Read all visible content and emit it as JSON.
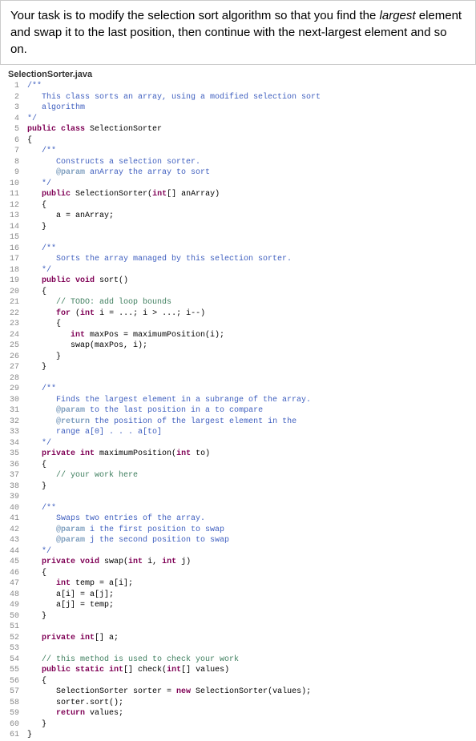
{
  "task": {
    "prefix": "Your task is to modify the selection sort algorithm so that you find the ",
    "italic1": "largest",
    "mid": " element and swap it to the last position, then continue with the next-largest element and so on."
  },
  "filename": "SelectionSorter.java",
  "lines": [
    {
      "n": "1",
      "spans": [
        {
          "c": "javadoc",
          "t": "/**"
        }
      ]
    },
    {
      "n": "2",
      "spans": [
        {
          "c": "javadoc",
          "t": "   This class sorts an array, using a modified selection sort"
        }
      ]
    },
    {
      "n": "3",
      "spans": [
        {
          "c": "javadoc",
          "t": "   algorithm"
        }
      ]
    },
    {
      "n": "4",
      "spans": [
        {
          "c": "javadoc",
          "t": "*/"
        }
      ]
    },
    {
      "n": "5",
      "spans": [
        {
          "c": "kw",
          "t": "public class"
        },
        {
          "c": "normal",
          "t": " SelectionSorter"
        }
      ]
    },
    {
      "n": "6",
      "spans": [
        {
          "c": "normal",
          "t": "{"
        }
      ]
    },
    {
      "n": "7",
      "spans": [
        {
          "c": "javadoc",
          "t": "   /**"
        }
      ]
    },
    {
      "n": "8",
      "spans": [
        {
          "c": "javadoc",
          "t": "      Constructs a selection sorter."
        }
      ]
    },
    {
      "n": "9",
      "spans": [
        {
          "c": "javadoc",
          "t": "      "
        },
        {
          "c": "tag",
          "t": "@param"
        },
        {
          "c": "javadoc",
          "t": " anArray the array to sort"
        }
      ]
    },
    {
      "n": "10",
      "spans": [
        {
          "c": "javadoc",
          "t": "   */"
        }
      ]
    },
    {
      "n": "11",
      "spans": [
        {
          "c": "normal",
          "t": "   "
        },
        {
          "c": "kw",
          "t": "public"
        },
        {
          "c": "normal",
          "t": " SelectionSorter("
        },
        {
          "c": "kw",
          "t": "int"
        },
        {
          "c": "normal",
          "t": "[] anArray)"
        }
      ]
    },
    {
      "n": "12",
      "spans": [
        {
          "c": "normal",
          "t": "   {"
        }
      ]
    },
    {
      "n": "13",
      "spans": [
        {
          "c": "normal",
          "t": "      a = anArray;"
        }
      ]
    },
    {
      "n": "14",
      "spans": [
        {
          "c": "normal",
          "t": "   }"
        }
      ]
    },
    {
      "n": "15",
      "spans": [
        {
          "c": "normal",
          "t": ""
        }
      ]
    },
    {
      "n": "16",
      "spans": [
        {
          "c": "javadoc",
          "t": "   /**"
        }
      ]
    },
    {
      "n": "17",
      "spans": [
        {
          "c": "javadoc",
          "t": "      Sorts the array managed by this selection sorter."
        }
      ]
    },
    {
      "n": "18",
      "spans": [
        {
          "c": "javadoc",
          "t": "   */"
        }
      ]
    },
    {
      "n": "19",
      "spans": [
        {
          "c": "normal",
          "t": "   "
        },
        {
          "c": "kw",
          "t": "public void"
        },
        {
          "c": "normal",
          "t": " sort()"
        }
      ]
    },
    {
      "n": "20",
      "spans": [
        {
          "c": "normal",
          "t": "   {"
        }
      ]
    },
    {
      "n": "21",
      "spans": [
        {
          "c": "normal",
          "t": "      "
        },
        {
          "c": "comment",
          "t": "// TODO: add loop bounds"
        }
      ]
    },
    {
      "n": "22",
      "spans": [
        {
          "c": "normal",
          "t": "      "
        },
        {
          "c": "kw",
          "t": "for"
        },
        {
          "c": "normal",
          "t": " ("
        },
        {
          "c": "kw",
          "t": "int"
        },
        {
          "c": "normal",
          "t": " i = ...; i > ...; i--)"
        }
      ]
    },
    {
      "n": "23",
      "spans": [
        {
          "c": "normal",
          "t": "      {"
        }
      ]
    },
    {
      "n": "24",
      "spans": [
        {
          "c": "normal",
          "t": "         "
        },
        {
          "c": "kw",
          "t": "int"
        },
        {
          "c": "normal",
          "t": " maxPos = maximumPosition(i);"
        }
      ]
    },
    {
      "n": "25",
      "spans": [
        {
          "c": "normal",
          "t": "         swap(maxPos, i);"
        }
      ]
    },
    {
      "n": "26",
      "spans": [
        {
          "c": "normal",
          "t": "      }"
        }
      ]
    },
    {
      "n": "27",
      "spans": [
        {
          "c": "normal",
          "t": "   }"
        }
      ]
    },
    {
      "n": "28",
      "spans": [
        {
          "c": "normal",
          "t": ""
        }
      ]
    },
    {
      "n": "29",
      "spans": [
        {
          "c": "javadoc",
          "t": "   /**"
        }
      ]
    },
    {
      "n": "30",
      "spans": [
        {
          "c": "javadoc",
          "t": "      Finds the largest element in a subrange of the array."
        }
      ]
    },
    {
      "n": "31",
      "spans": [
        {
          "c": "javadoc",
          "t": "      "
        },
        {
          "c": "tag",
          "t": "@param"
        },
        {
          "c": "javadoc",
          "t": " to the last position in a to compare"
        }
      ]
    },
    {
      "n": "32",
      "spans": [
        {
          "c": "javadoc",
          "t": "      "
        },
        {
          "c": "tag",
          "t": "@return"
        },
        {
          "c": "javadoc",
          "t": " the position of the largest element in the"
        }
      ]
    },
    {
      "n": "33",
      "spans": [
        {
          "c": "javadoc",
          "t": "      range a[0] . . . a[to]"
        }
      ]
    },
    {
      "n": "34",
      "spans": [
        {
          "c": "javadoc",
          "t": "   */"
        }
      ]
    },
    {
      "n": "35",
      "spans": [
        {
          "c": "normal",
          "t": "   "
        },
        {
          "c": "kw",
          "t": "private int"
        },
        {
          "c": "normal",
          "t": " maximumPosition("
        },
        {
          "c": "kw",
          "t": "int"
        },
        {
          "c": "normal",
          "t": " to)"
        }
      ]
    },
    {
      "n": "36",
      "spans": [
        {
          "c": "normal",
          "t": "   {"
        }
      ]
    },
    {
      "n": "37",
      "spans": [
        {
          "c": "normal",
          "t": "      "
        },
        {
          "c": "comment",
          "t": "// your work here"
        }
      ]
    },
    {
      "n": "38",
      "spans": [
        {
          "c": "normal",
          "t": "   }"
        }
      ]
    },
    {
      "n": "39",
      "spans": [
        {
          "c": "normal",
          "t": ""
        }
      ]
    },
    {
      "n": "40",
      "spans": [
        {
          "c": "javadoc",
          "t": "   /**"
        }
      ]
    },
    {
      "n": "41",
      "spans": [
        {
          "c": "javadoc",
          "t": "      Swaps two entries of the array."
        }
      ]
    },
    {
      "n": "42",
      "spans": [
        {
          "c": "javadoc",
          "t": "      "
        },
        {
          "c": "tag",
          "t": "@param"
        },
        {
          "c": "javadoc",
          "t": " i the first position to swap"
        }
      ]
    },
    {
      "n": "43",
      "spans": [
        {
          "c": "javadoc",
          "t": "      "
        },
        {
          "c": "tag",
          "t": "@param"
        },
        {
          "c": "javadoc",
          "t": " j the second position to swap"
        }
      ]
    },
    {
      "n": "44",
      "spans": [
        {
          "c": "javadoc",
          "t": "   */"
        }
      ]
    },
    {
      "n": "45",
      "spans": [
        {
          "c": "normal",
          "t": "   "
        },
        {
          "c": "kw",
          "t": "private void"
        },
        {
          "c": "normal",
          "t": " swap("
        },
        {
          "c": "kw",
          "t": "int"
        },
        {
          "c": "normal",
          "t": " i, "
        },
        {
          "c": "kw",
          "t": "int"
        },
        {
          "c": "normal",
          "t": " j)"
        }
      ]
    },
    {
      "n": "46",
      "spans": [
        {
          "c": "normal",
          "t": "   {"
        }
      ]
    },
    {
      "n": "47",
      "spans": [
        {
          "c": "normal",
          "t": "      "
        },
        {
          "c": "kw",
          "t": "int"
        },
        {
          "c": "normal",
          "t": " temp = a[i];"
        }
      ]
    },
    {
      "n": "48",
      "spans": [
        {
          "c": "normal",
          "t": "      a[i] = a[j];"
        }
      ]
    },
    {
      "n": "49",
      "spans": [
        {
          "c": "normal",
          "t": "      a[j] = temp;"
        }
      ]
    },
    {
      "n": "50",
      "spans": [
        {
          "c": "normal",
          "t": "   }"
        }
      ]
    },
    {
      "n": "51",
      "spans": [
        {
          "c": "normal",
          "t": ""
        }
      ]
    },
    {
      "n": "52",
      "spans": [
        {
          "c": "normal",
          "t": "   "
        },
        {
          "c": "kw",
          "t": "private int"
        },
        {
          "c": "normal",
          "t": "[] a;"
        }
      ]
    },
    {
      "n": "53",
      "spans": [
        {
          "c": "normal",
          "t": ""
        }
      ]
    },
    {
      "n": "54",
      "spans": [
        {
          "c": "normal",
          "t": "   "
        },
        {
          "c": "comment",
          "t": "// this method is used to check your work"
        }
      ]
    },
    {
      "n": "55",
      "spans": [
        {
          "c": "normal",
          "t": "   "
        },
        {
          "c": "kw",
          "t": "public static int"
        },
        {
          "c": "normal",
          "t": "[] check("
        },
        {
          "c": "kw",
          "t": "int"
        },
        {
          "c": "normal",
          "t": "[] values)"
        }
      ]
    },
    {
      "n": "56",
      "spans": [
        {
          "c": "normal",
          "t": "   {"
        }
      ]
    },
    {
      "n": "57",
      "spans": [
        {
          "c": "normal",
          "t": "      SelectionSorter sorter = "
        },
        {
          "c": "kw",
          "t": "new"
        },
        {
          "c": "normal",
          "t": " SelectionSorter(values);"
        }
      ]
    },
    {
      "n": "58",
      "spans": [
        {
          "c": "normal",
          "t": "      sorter.sort();"
        }
      ]
    },
    {
      "n": "59",
      "spans": [
        {
          "c": "normal",
          "t": "      "
        },
        {
          "c": "kw",
          "t": "return"
        },
        {
          "c": "normal",
          "t": " values;"
        }
      ]
    },
    {
      "n": "60",
      "spans": [
        {
          "c": "normal",
          "t": "   }"
        }
      ]
    },
    {
      "n": "61",
      "spans": [
        {
          "c": "normal",
          "t": "}"
        }
      ]
    }
  ]
}
